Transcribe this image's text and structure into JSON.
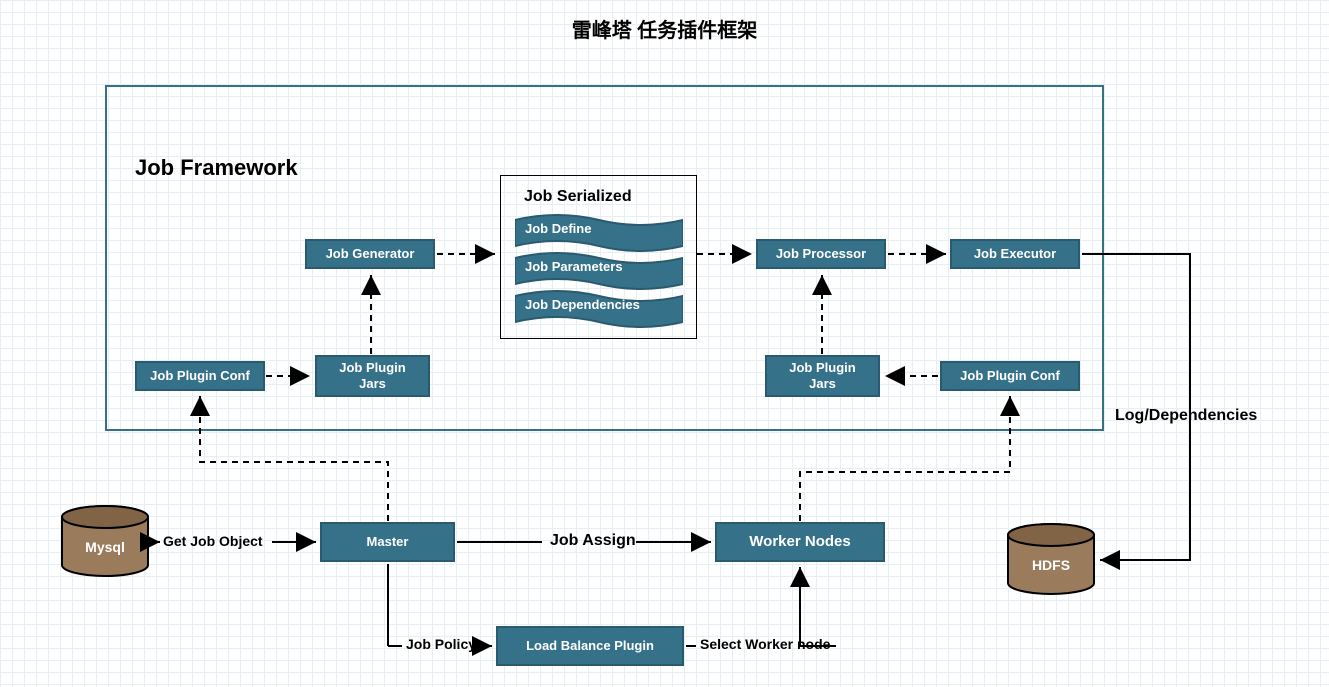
{
  "title": "雷峰塔 任务插件框架",
  "framework": {
    "heading": "Job Framework",
    "plugin_conf_left": "Job Plugin Conf",
    "plugin_jars_left": "Job Plugin\nJars",
    "generator": "Job Generator",
    "serialized": {
      "title": "Job Serialized",
      "define": "Job Define",
      "parameters": "Job Parameters",
      "dependencies": "Job Dependencies"
    },
    "processor": "Job Processor",
    "executor": "Job Executor",
    "plugin_jars_right": "Job Plugin\nJars",
    "plugin_conf_right": "Job Plugin Conf"
  },
  "nodes": {
    "mysql": "Mysql",
    "master": "Master",
    "worker": "Worker Nodes",
    "hdfs": "HDFS",
    "load_balance": "Load Balance Plugin"
  },
  "edges": {
    "get_job": "Get Job Object",
    "job_assign": "Job Assign",
    "log_deps": "Log/Dependencies",
    "job_policy": "Job Policy",
    "select_worker": "Select Worker node"
  }
}
